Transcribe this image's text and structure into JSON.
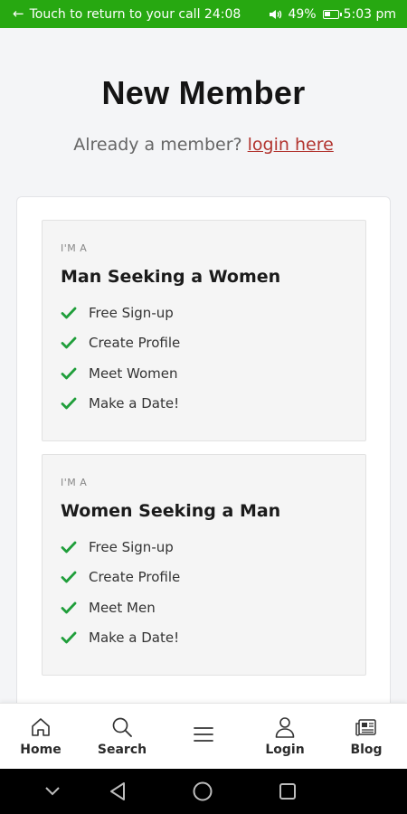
{
  "status_bar": {
    "call_text": "Touch to return to your call 24:08",
    "battery": "49%",
    "battery_level": 0.49,
    "time": "5:03 pm"
  },
  "header": {
    "title": "New Member",
    "login_prompt": "Already a member?",
    "login_link": "login here"
  },
  "options": [
    {
      "kicker": "I'M A",
      "title": "Man Seeking a Women",
      "features": [
        "Free Sign-up",
        "Create Profile",
        "Meet Women",
        "Make a Date!"
      ]
    },
    {
      "kicker": "I'M A",
      "title": "Women Seeking a Man",
      "features": [
        "Free Sign-up",
        "Create Profile",
        "Meet Men",
        "Make a Date!"
      ]
    }
  ],
  "bottom_nav": [
    {
      "label": "Home",
      "icon": "home-icon"
    },
    {
      "label": "Search",
      "icon": "search-icon"
    },
    {
      "label": "",
      "icon": "menu-icon"
    },
    {
      "label": "Login",
      "icon": "user-icon"
    },
    {
      "label": "Blog",
      "icon": "newspaper-icon"
    }
  ],
  "colors": {
    "status_bar": "#27a811",
    "check": "#1f9e3a",
    "link": "#b2342f"
  }
}
